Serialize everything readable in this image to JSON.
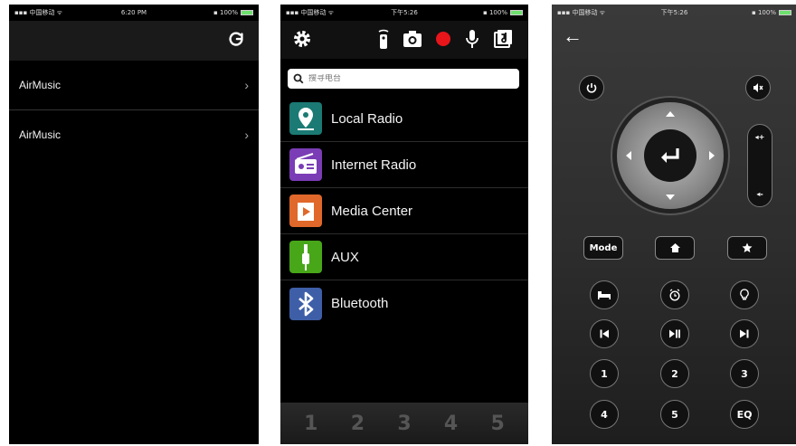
{
  "status1": {
    "carrier": "▪▪▪ 中国移动 ᯤ",
    "time": "6:20 PM",
    "battery": "▪ 100%"
  },
  "status2": {
    "carrier": "▪▪▪ 中国移动 ᯤ",
    "time": "下午5:26",
    "battery": "▪ 100%"
  },
  "status3": {
    "carrier": "▪▪▪ 中国移动 ᯤ",
    "time": "下午5:26",
    "battery": "▪ 100%"
  },
  "devices": {
    "items": [
      {
        "label": "AirMusic"
      },
      {
        "label": "AirMusic"
      }
    ],
    "refresh_icon": "refresh-icon"
  },
  "source": {
    "toolbar_icons": [
      "settings-icon",
      "remote-icon",
      "camera-icon",
      "record-icon",
      "microphone-icon",
      "music-note-icon"
    ],
    "record_color": "#e8151b",
    "search_placeholder": "搜寻电台",
    "items": [
      {
        "label": "Local Radio",
        "color": "#1b7a74",
        "icon": "map-pin-icon"
      },
      {
        "label": "Internet Radio",
        "color": "#7a3db5",
        "icon": "radio-icon"
      },
      {
        "label": "Media Center",
        "color": "#e0682a",
        "icon": "play-icon"
      },
      {
        "label": "AUX",
        "color": "#48a619",
        "icon": "audio-jack-icon"
      },
      {
        "label": "Bluetooth",
        "color": "#3e5fa8",
        "icon": "bluetooth-icon"
      }
    ],
    "pages": [
      "1",
      "2",
      "3",
      "4",
      "5"
    ]
  },
  "remote": {
    "back_icon": "back-arrow-icon",
    "mode_label": "Mode",
    "numbers": [
      "1",
      "2",
      "3",
      "4",
      "5"
    ],
    "eq_label": "EQ"
  }
}
